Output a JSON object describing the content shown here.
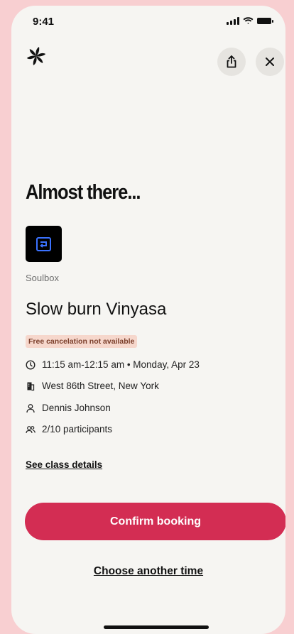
{
  "status_bar": {
    "time": "9:41"
  },
  "header": {
    "logo_icon": "pinwheel-logo-icon",
    "share_icon": "share-icon",
    "close_icon": "close-icon"
  },
  "main": {
    "title": "Almost there...",
    "studio_name": "Soulbox",
    "class_name": "Slow burn Vinyasa",
    "badge": "Free cancelation not available",
    "details": {
      "time": "11:15 am-12:15 am • Monday, Apr 23",
      "location": "West 86th Street, New York",
      "instructor": "Dennis Johnson",
      "participants": "2/10 participants"
    },
    "see_details_link": "See class details",
    "confirm_button": "Confirm booking",
    "another_time_link": "Choose another time"
  },
  "colors": {
    "accent": "#d32d53",
    "page_background": "#f8cfd1",
    "card_background": "#f6f5f2",
    "badge_background": "#f6d7cc",
    "badge_text": "#7b3f2b"
  }
}
